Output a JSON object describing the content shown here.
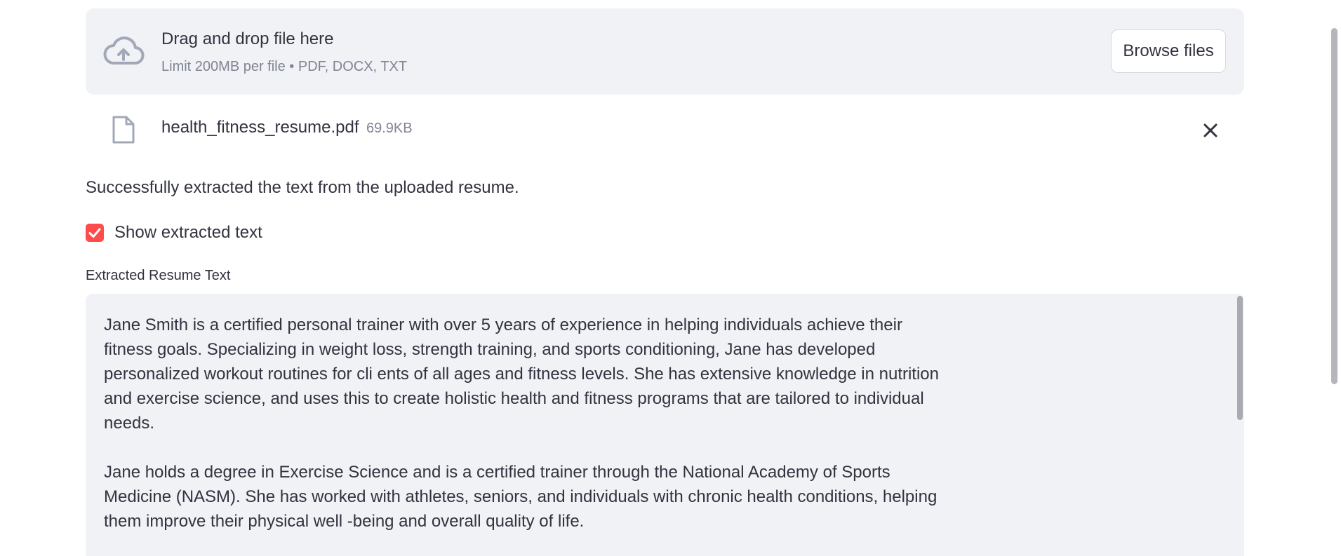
{
  "uploader": {
    "title": "Drag and drop file here",
    "subtitle": "Limit 200MB per file • PDF, DOCX, TXT",
    "browse_label": "Browse files",
    "icon": "cloud-upload-icon"
  },
  "file": {
    "name": "health_fitness_resume.pdf",
    "size": "69.9KB",
    "icon": "file-icon",
    "remove_icon": "close-icon"
  },
  "status": {
    "message": "Successfully extracted the text from the uploaded resume."
  },
  "checkbox": {
    "label": "Show extracted text",
    "checked": true,
    "color": "#ff4b4b"
  },
  "textarea": {
    "label": "Extracted Resume Text",
    "paragraphs": [
      "Jane Smith is a certified personal trainer with over 5 years of experience in helping individuals achieve their fitness goals. Specializing in weight loss, strength training, and sports conditioning, Jane has developed personalized workout routines for cli ents of all ages and fitness levels. She has extensive knowledge in nutrition and exercise science, and uses this to create holistic health and fitness programs that are tailored to individual needs.",
      "Jane holds a degree in Exercise Science and is a certified trainer through the National Academy of Sports Medicine (NASM). She has worked with athletes, seniors, and individuals with chronic health conditions, helping them improve their physical well -being  and overall quality of life."
    ]
  },
  "colors": {
    "panel_bg": "#f0f2f6",
    "text": "#31333f",
    "muted": "#808495",
    "accent": "#ff4b4b"
  }
}
